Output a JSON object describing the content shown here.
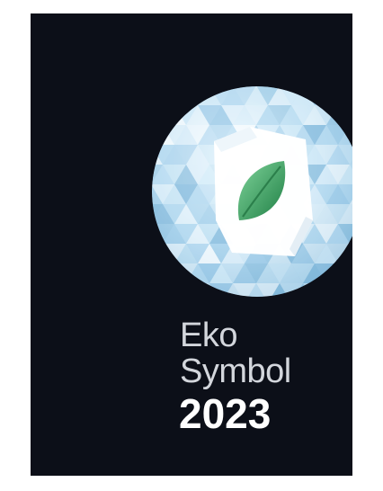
{
  "badge": {
    "line_1": "Eko",
    "line_2": "Symbol",
    "line_3": "2023",
    "colors": {
      "background": "#0c0f18",
      "caption": "#d3d6dc",
      "year": "#ffffff",
      "crystal_light": "#e8f4fb",
      "crystal_mid": "#a9d3ec",
      "crystal_dark": "#6fa9cf",
      "leaf_light": "#5fc37f",
      "leaf_dark": "#2b8a4d"
    },
    "icons": [
      "crystal-globe-icon",
      "white-cube-icon",
      "leaf-icon"
    ]
  }
}
